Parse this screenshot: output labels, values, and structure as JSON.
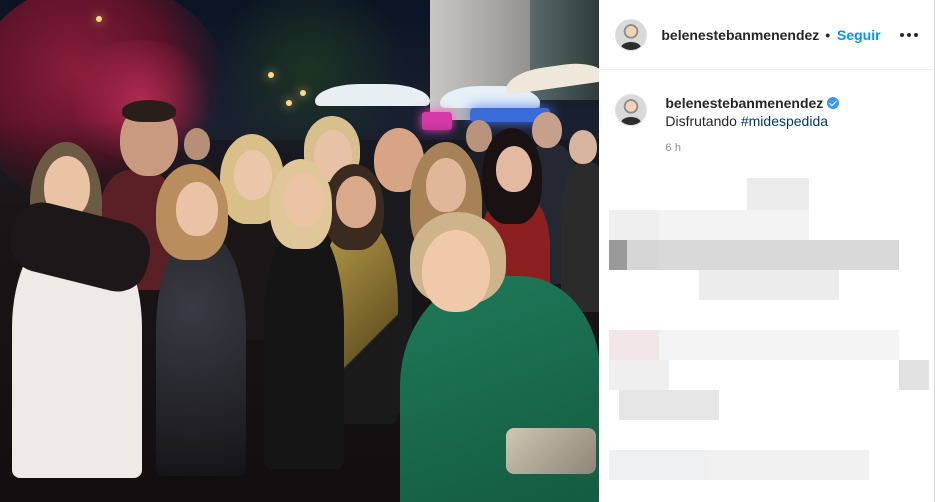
{
  "post": {
    "username": "belenestebanmenendez",
    "separator": "•",
    "follow_label": "Seguir",
    "caption_username": "belenestebanmenendez",
    "caption_text": "Disfrutando",
    "caption_hashtag": "#midespedida",
    "time_ago": "6 h",
    "icons": {
      "verified": "verified-badge-icon",
      "more": "more-options-icon"
    },
    "colors": {
      "follow": "#0095f6",
      "hashtag": "#00376b",
      "verified": "#3897f0"
    }
  }
}
